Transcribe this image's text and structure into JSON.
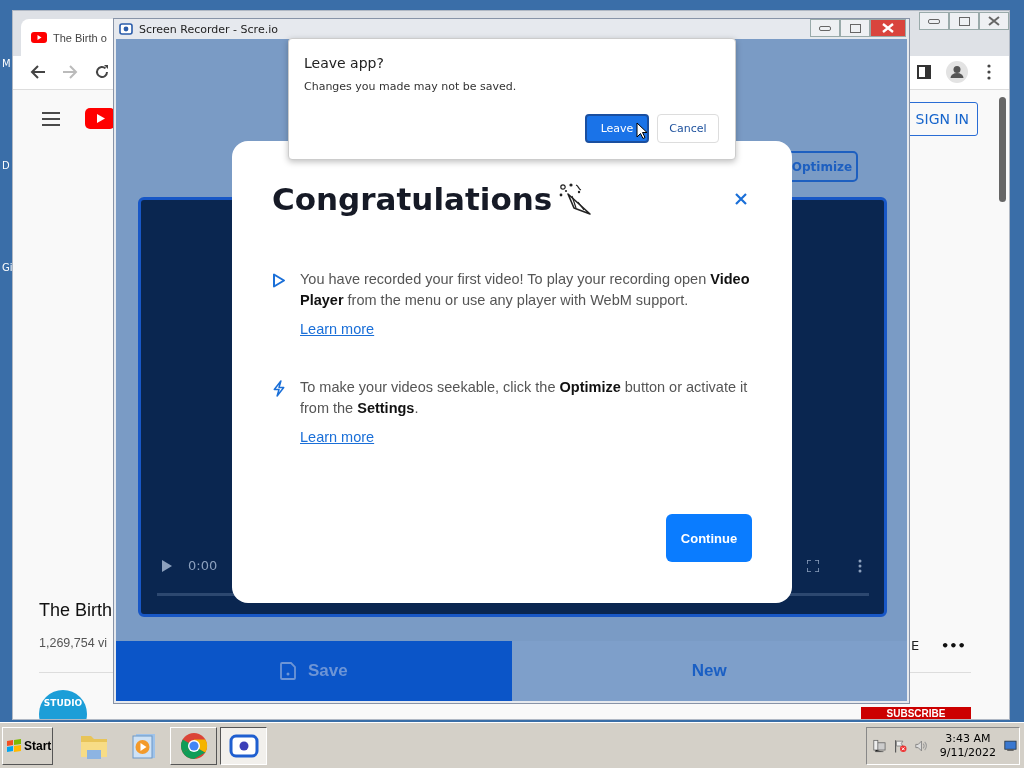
{
  "desktop": {
    "icon_labels": [
      "M",
      "D",
      "Gi"
    ]
  },
  "browser": {
    "tab_title": "The Birth o",
    "sign_in": "SIGN IN",
    "video_title": "The Birth",
    "views": "1,269,754 vi",
    "action_fragment": "E",
    "more": "•••",
    "channel_badge": "STUDIO",
    "subscribe": "SUBSCRIBE"
  },
  "recorder": {
    "title": "Screen Recorder - Scre.io",
    "optimize": "Optimize",
    "time": "0:00",
    "actions": [
      {
        "kind": "save",
        "label": "Save",
        "selected": true
      },
      {
        "kind": "new",
        "label": "New",
        "selected": false
      }
    ]
  },
  "modal": {
    "title": "Congratulations",
    "items": [
      {
        "kind": "play",
        "text": "You have recorded your first video! To play your recording open **Video Player** from the menu or use any player with WebM support.",
        "link": "Learn more"
      },
      {
        "kind": "bolt",
        "text": "To make your videos seekable, click the **Optimize** button or activate it from the **Settings**.",
        "link": "Learn more"
      }
    ],
    "button": "Continue"
  },
  "dialog": {
    "title": "Leave app?",
    "message": "Changes you made may not be saved.",
    "buttons": [
      {
        "label": "Leave",
        "focused": true
      },
      {
        "label": "Cancel",
        "focused": false
      }
    ]
  },
  "taskbar": {
    "start": "Start",
    "apps": [
      {
        "kind": "folder",
        "open": false,
        "selected": false
      },
      {
        "kind": "media",
        "open": false,
        "selected": false
      },
      {
        "kind": "chrome",
        "open": true,
        "selected": false
      },
      {
        "kind": "recorder",
        "open": true,
        "selected": true
      }
    ],
    "time": "3:43 AM",
    "date": "9/11/2022"
  }
}
